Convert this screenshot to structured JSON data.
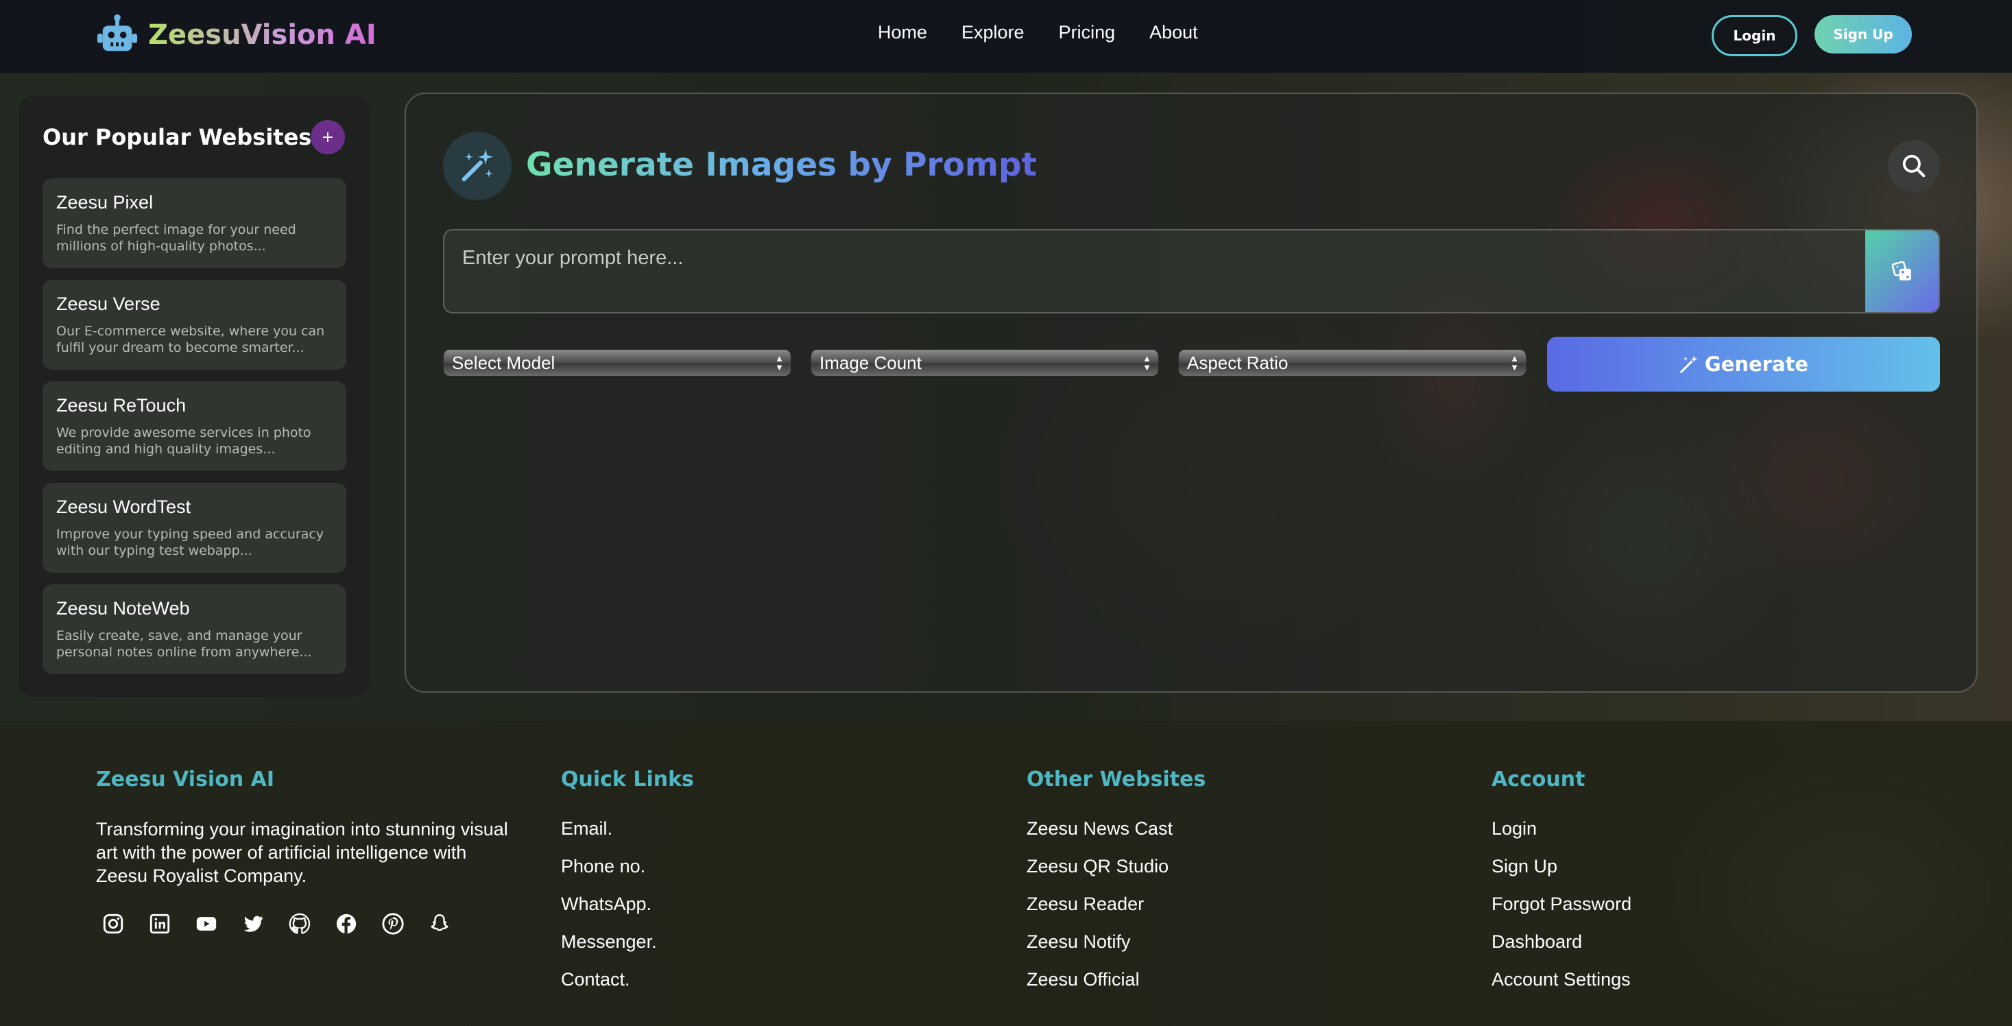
{
  "brand": {
    "name": "ZeesuVision AI"
  },
  "nav": {
    "items": [
      "Home",
      "Explore",
      "Pricing",
      "About"
    ]
  },
  "auth": {
    "login_label": "Login",
    "signup_label": "Sign Up"
  },
  "sidebar": {
    "title": "Our Popular Websites",
    "add_label": "+",
    "items": [
      {
        "name": "Zeesu Pixel",
        "desc": "Find the perfect image for your need millions of high-quality photos..."
      },
      {
        "name": "Zeesu Verse",
        "desc": "Our E-commerce website, where you can fulfil your dream to become smarter..."
      },
      {
        "name": "Zeesu ReTouch",
        "desc": "We provide awesome services in photo editing and high quality images..."
      },
      {
        "name": "Zeesu WordTest",
        "desc": "Improve your typing speed and accuracy with our typing test webapp..."
      },
      {
        "name": "Zeesu NoteWeb",
        "desc": "Easily create, save, and manage your personal notes online from anywhere..."
      }
    ]
  },
  "main": {
    "title": "Generate Images by Prompt",
    "prompt": {
      "value": "",
      "placeholder": "Enter your prompt here..."
    },
    "selects": {
      "model": "Select Model",
      "count": "Image Count",
      "aspect": "Aspect Ratio"
    },
    "generate_label": "Generate"
  },
  "footer": {
    "brand": {
      "title": "Zeesu Vision AI",
      "desc": "Transforming your imagination into stunning visual art with the power of artificial intelligence with Zeesu Royalist Company."
    },
    "socials": [
      "instagram-icon",
      "linkedin-icon",
      "youtube-icon",
      "twitter-icon",
      "github-icon",
      "facebook-icon",
      "pinterest-icon",
      "snapchat-icon"
    ],
    "quick_links": {
      "title": "Quick Links",
      "items": [
        "Email.",
        "Phone no.",
        "WhatsApp.",
        "Messenger.",
        "Contact."
      ]
    },
    "other_sites": {
      "title": "Other Websites",
      "items": [
        "Zeesu News Cast",
        "Zeesu QR Studio",
        "Zeesu Reader",
        "Zeesu Notify",
        "Zeesu Official"
      ]
    },
    "account": {
      "title": "Account",
      "items": [
        "Login",
        "Sign Up",
        "Forgot Password",
        "Dashboard",
        "Account Settings"
      ]
    }
  },
  "colors": {
    "accent": "#4fb7c4",
    "generate_start": "#5a6ae6",
    "generate_end": "#63c0ea",
    "sidebar_add": "#6b2f8a"
  }
}
